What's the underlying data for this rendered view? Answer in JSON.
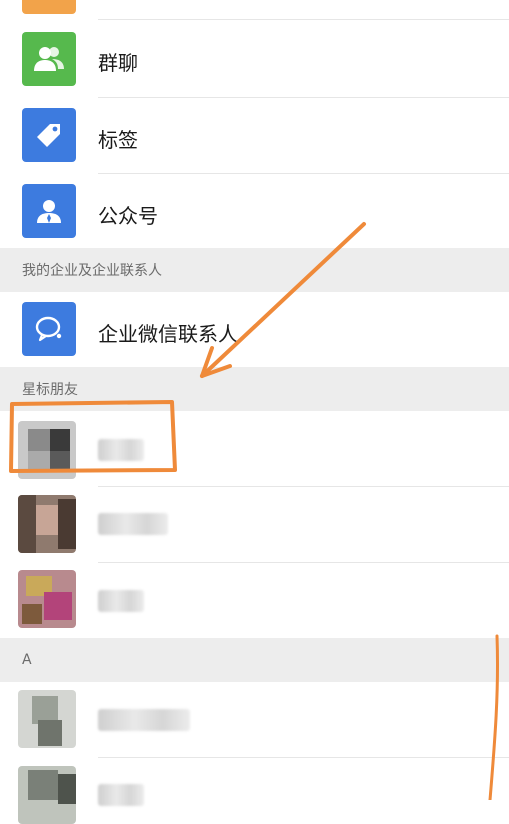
{
  "menu": {
    "group_chat": "群聊",
    "tags": "标签",
    "official_accounts": "公众号"
  },
  "sections": {
    "enterprise": "我的企业及企业联系人",
    "starred": "星标朋友",
    "letter_a": "A"
  },
  "enterprise": {
    "wecom_contacts": "企业微信联系人"
  },
  "colors": {
    "green": "#56b94d",
    "blue": "#3d7bdf",
    "orange_annotation": "#ef8a3a",
    "top_partial_icon": "#f2a34a"
  }
}
